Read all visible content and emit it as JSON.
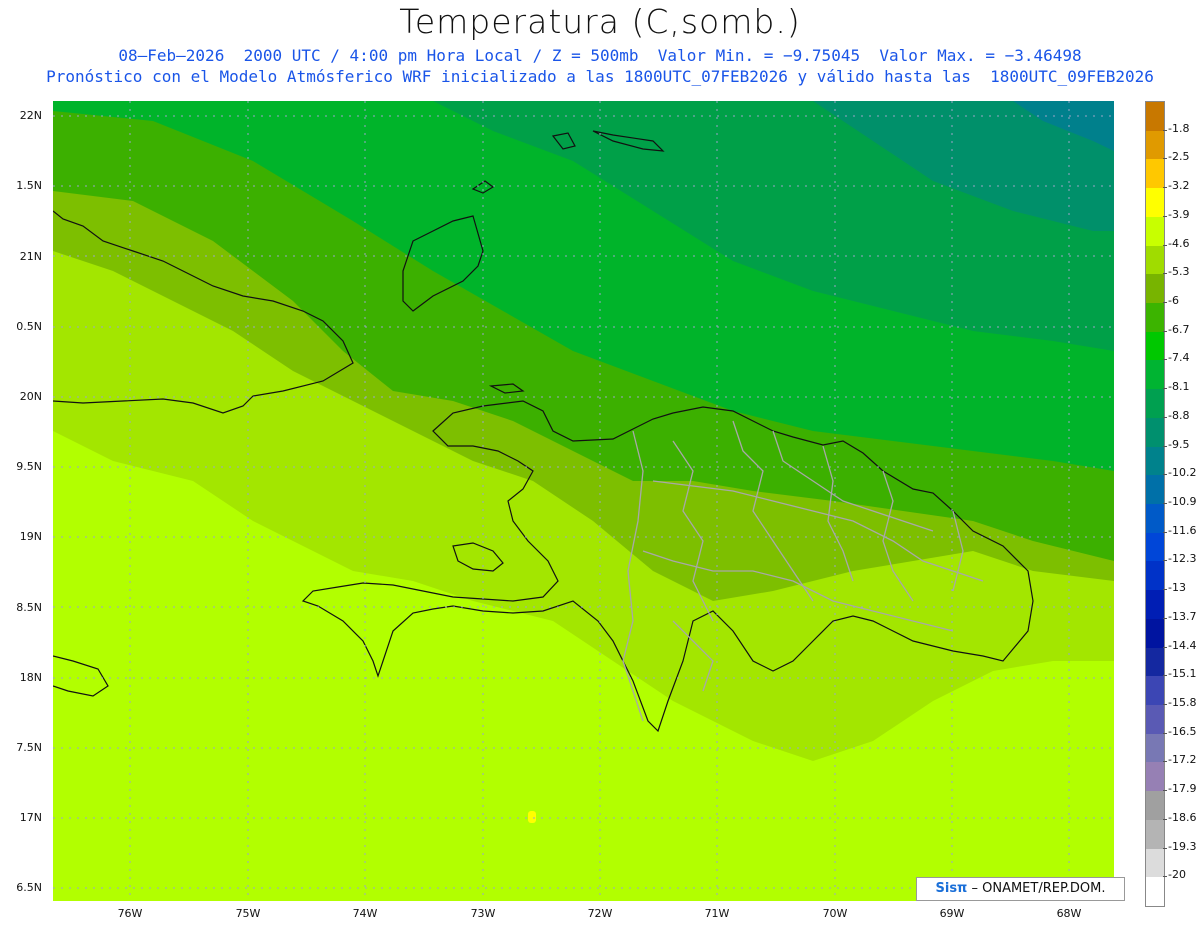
{
  "title": "Temperatura (C,somb.)",
  "subtitle_line1": "08–Feb–2026  2000 UTC / 4:00 pm Hora Local / Z = 500mb  Valor Min. = −9.75045  Valor Max. = −3.46498",
  "subtitle_line2": "Pronóstico con el Modelo Atmósferico WRF inicializado a las 1800UTC_07FEB2026 y válido hasta las  1800UTC_09FEB2026",
  "lat_labels": [
    "22N",
    "1.5N",
    "21N",
    "0.5N",
    "20N",
    "9.5N",
    "19N",
    "8.5N",
    "18N",
    "7.5N",
    "17N",
    "6.5N"
  ],
  "lon_labels": [
    "76W",
    "75W",
    "74W",
    "73W",
    "72W",
    "71W",
    "70W",
    "69W",
    "68W"
  ],
  "colorbar": {
    "labels": [
      "-1.8",
      "-2.5",
      "-3.2",
      "-3.9",
      "-4.6",
      "-5.3",
      "-6",
      "-6.7",
      "-7.4",
      "-8.1",
      "-8.8",
      "-9.5",
      "-10.2",
      "-10.9",
      "-11.6",
      "-12.3",
      "-13",
      "-13.7",
      "-14.4",
      "-15.1",
      "-15.8",
      "-16.5",
      "-17.2",
      "-17.9",
      "-18.6",
      "-19.3",
      "-20"
    ],
    "colors": [
      "#c87800",
      "#e09a00",
      "#ffc800",
      "#ffff00",
      "#c8ff00",
      "#a0dc00",
      "#78b400",
      "#3cb400",
      "#00c800",
      "#00b432",
      "#00a050",
      "#00906e",
      "#00828c",
      "#0070a8",
      "#005ac8",
      "#0046d8",
      "#0032c8",
      "#001eb4",
      "#0014a0",
      "#1428a0",
      "#3c46b4",
      "#5a5ab4",
      "#7878b4",
      "#9680b4",
      "#a0a0a0",
      "#b4b4b4",
      "#dcdcdc",
      "#ffffff"
    ]
  },
  "credit": {
    "logo": "Sisπ",
    "text": " – ONAMET/REP.DOM."
  }
}
